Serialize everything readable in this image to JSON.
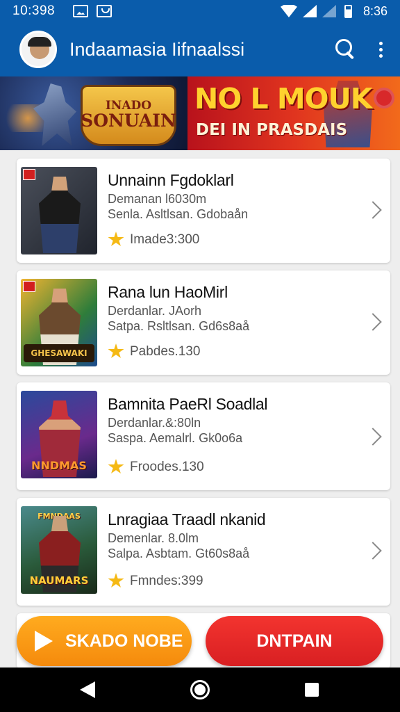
{
  "status_bar": {
    "time": "10:398",
    "clock": "8:36"
  },
  "app_bar": {
    "title": "Indaamasia Iifnaalssi"
  },
  "banner": {
    "left_badge_line1": "INADO",
    "left_badge_line2": "SONUAIN",
    "right_title": "NO L MOUK",
    "right_subtitle": "DEI IN PRASDAIS"
  },
  "items": [
    {
      "title": "Unnainn Fgdoklarl",
      "line1": "Demanan l6030m",
      "line2": "Senla. Asltlsan. Gdobaån",
      "rating": "Imade3:300"
    },
    {
      "title": "Rana lun HaoMirl",
      "line1": "Derdanlar. JAorh",
      "line2": "Satpa. Rsltlsan. Gd6s8aå",
      "rating": "Pabdes.130"
    },
    {
      "title": "Bamnita PaeRl Soadlal",
      "line1": "Derdanlar.&:80ln",
      "line2": "Saspa. Aemalrl. Gk0o6a",
      "rating": "Froodes.130"
    },
    {
      "title": "Lnragiaa Traadl nkanid",
      "line1": "Demenlar. 8.0lm",
      "line2": "Salpa. Asbtam. Gt60s8aå",
      "rating": "Fmndes:399"
    }
  ],
  "thumb_labels": [
    "",
    "GHESAWAKI",
    "NNDMAS",
    "NAUMARS"
  ],
  "thumb_top_labels": [
    "",
    "",
    "",
    "FMNDAAS"
  ],
  "buttons": {
    "primary_label": "SKADO NOBE",
    "secondary_label": "DNTPAIN"
  },
  "colors": {
    "app_bar": "#0a5cab",
    "primary_button": "#f7941d",
    "secondary_button": "#e52a27",
    "star": "#f5b914"
  }
}
